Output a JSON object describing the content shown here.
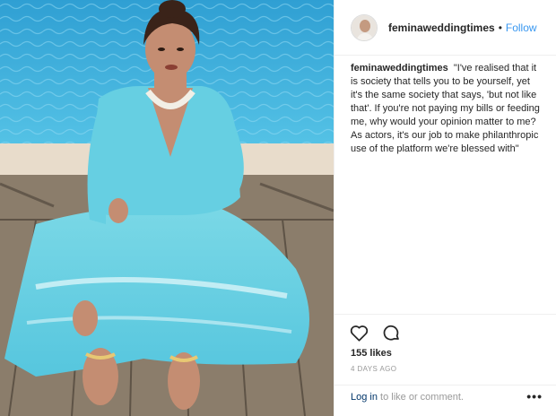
{
  "post": {
    "image_alt": "Woman in a turquoise embroidered outfit seated on a wooden deck beside a pool",
    "header": {
      "username": "feminaweddingtimes",
      "separator": "•",
      "follow_label": "Follow"
    },
    "caption": {
      "username": "feminaweddingtimes",
      "text": "\"I've realised that it is society that tells you to be yourself, yet it's the same society that says, 'but not like that'. If you're not paying my bills or feeding me, why would your opinion matter to me? As actors, it's our job to make philanthropic use of the platform we're blessed with\""
    },
    "actions": {
      "like_icon": "heart-icon",
      "comment_icon": "comment-icon"
    },
    "likes": "155 likes",
    "time_ago": "4 DAYS AGO",
    "comment_bar": {
      "login_label": "Log in",
      "prompt": " to like or comment.",
      "more_label": "•••"
    },
    "colors": {
      "link": "#3897f0",
      "text": "#262626",
      "muted": "#999999",
      "pool": "#2a9fd0",
      "outfit": "#6fd3e3"
    }
  }
}
